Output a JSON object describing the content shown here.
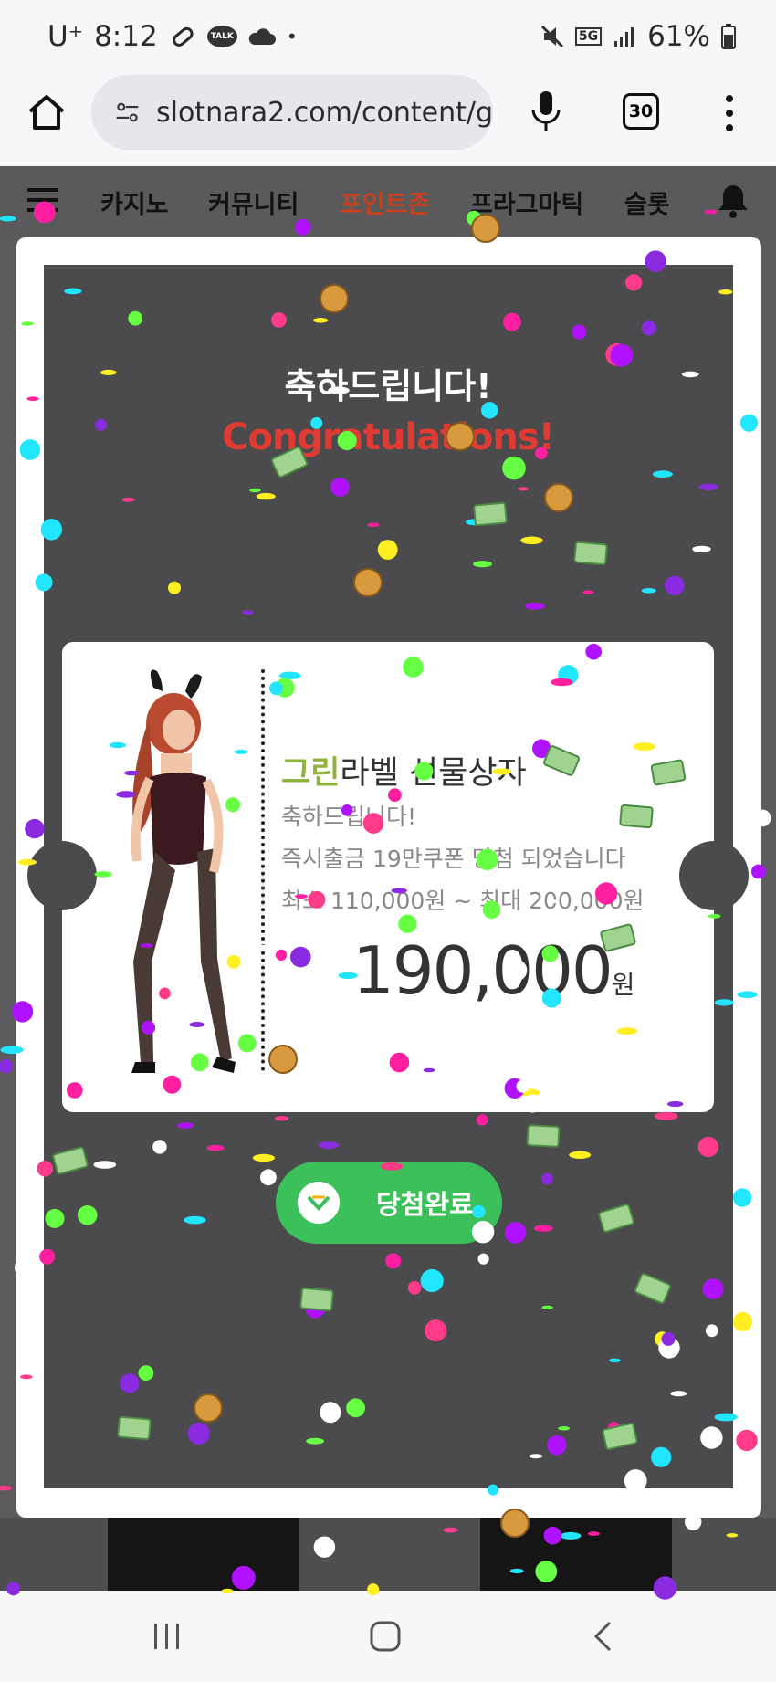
{
  "status_bar": {
    "carrier": "U⁺",
    "time": "8:12",
    "talk_badge": "TALK",
    "network": "5G",
    "battery": "61%"
  },
  "browser": {
    "url": "slotnara2.com/content/g",
    "tab_count": "30"
  },
  "site_nav": {
    "items": [
      "카지노",
      "커뮤니티",
      "포인트존",
      "프라그마틱",
      "슬롯"
    ],
    "active_index": 2,
    "active_color": "#c7421c"
  },
  "modal": {
    "title": "축하드립니다!",
    "subtitle": "Congratulations!",
    "ticket": {
      "prize_highlight": "그린",
      "prize_rest": "라벨 선물상자",
      "line1": "축하드립니다!",
      "line2": "즉시출금 19만쿠폰 당첨 되었습니다",
      "line3": "최소 110,000원 ~ 최대 200,000원",
      "amount": "190,000",
      "amount_unit": "원"
    },
    "button_label": "당첨완료"
  },
  "colors": {
    "accent_green": "#3cc05a",
    "title_red": "#e03b32",
    "prize_green": "#8fb33c"
  },
  "icons": [
    "home-icon",
    "tune-icon",
    "mic-icon",
    "tabs-icon",
    "more-icon",
    "menu-icon",
    "bell-icon",
    "check-icon",
    "recent-apps-icon",
    "home-nav-icon",
    "back-icon"
  ]
}
